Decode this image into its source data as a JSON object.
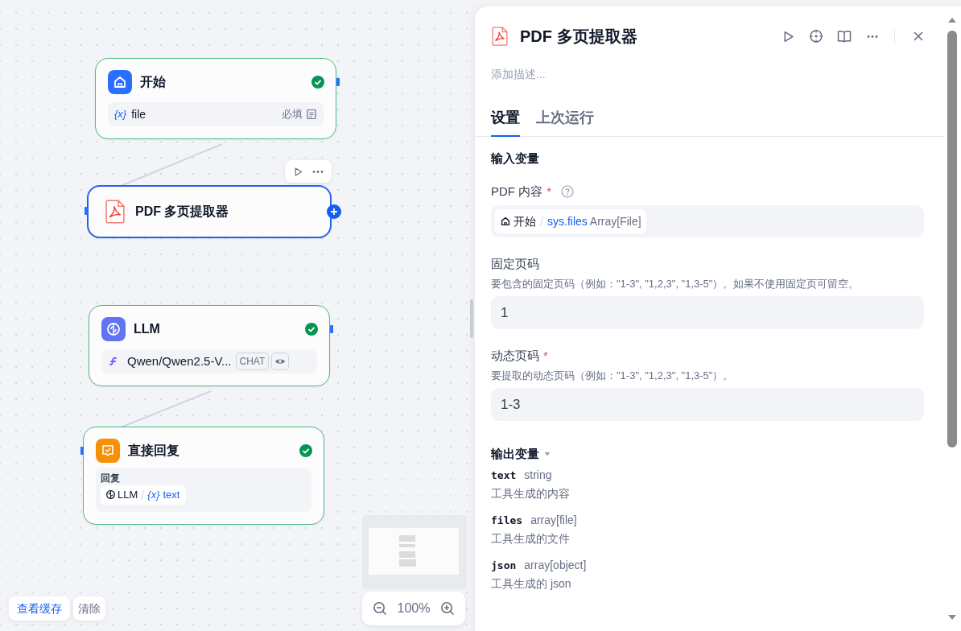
{
  "canvas": {
    "nodes": [
      {
        "kind": "start",
        "title": "开始",
        "selected": false,
        "succeeded": true,
        "variable": {
          "prefix": "{x}",
          "name": "file",
          "tag": "必填"
        }
      },
      {
        "kind": "tool",
        "title": "PDF 多页提取器",
        "selected": true,
        "succeeded": false
      },
      {
        "kind": "llm",
        "title": "LLM",
        "selected": false,
        "succeeded": true,
        "model": {
          "name": "Qwen/Qwen2.5-V...",
          "mode": "CHAT"
        }
      },
      {
        "kind": "answer",
        "title": "直接回复",
        "selected": false,
        "succeeded": true,
        "field_label": "回复",
        "reference": {
          "node": "LLM",
          "prefix": "{x}",
          "variable": "text"
        }
      }
    ],
    "cache_buttons": [
      {
        "label": "查看缓存",
        "kind": "link"
      },
      {
        "label": "清除",
        "kind": "plain"
      }
    ],
    "zoom": "100%"
  },
  "panel": {
    "title": "PDF 多页提取器",
    "description_placeholder": "添加描述...",
    "tabs": [
      {
        "label": "设置",
        "selected": true
      },
      {
        "label": "上次运行",
        "selected": false
      }
    ],
    "input_section": "输入变量",
    "inputs": [
      {
        "kind": "variable",
        "label": "PDF 内容",
        "required_mark": "*",
        "help": true,
        "source_node": "开始",
        "variable": "sys.files",
        "type": "Array[File]"
      },
      {
        "kind": "text",
        "label": "固定页码",
        "description": "要包含的固定页码（例如：\"1-3\", \"1,2,3\", \"1,3-5\"）。如果不使用固定页可留空。",
        "value": "1"
      },
      {
        "kind": "text",
        "label": "动态页码",
        "required_mark": "*",
        "description": "要提取的动态页码（例如：\"1-3\", \"1,2,3\", \"1,3-5\"）。",
        "value": "1-3"
      }
    ],
    "output_section": "输出变量",
    "outputs": [
      {
        "name": "text",
        "type": "string",
        "description": "工具生成的内容"
      },
      {
        "name": "files",
        "type": "array[file]",
        "description": "工具生成的文件"
      },
      {
        "name": "json",
        "type": "array[object]",
        "description": "工具生成的 json"
      }
    ]
  }
}
